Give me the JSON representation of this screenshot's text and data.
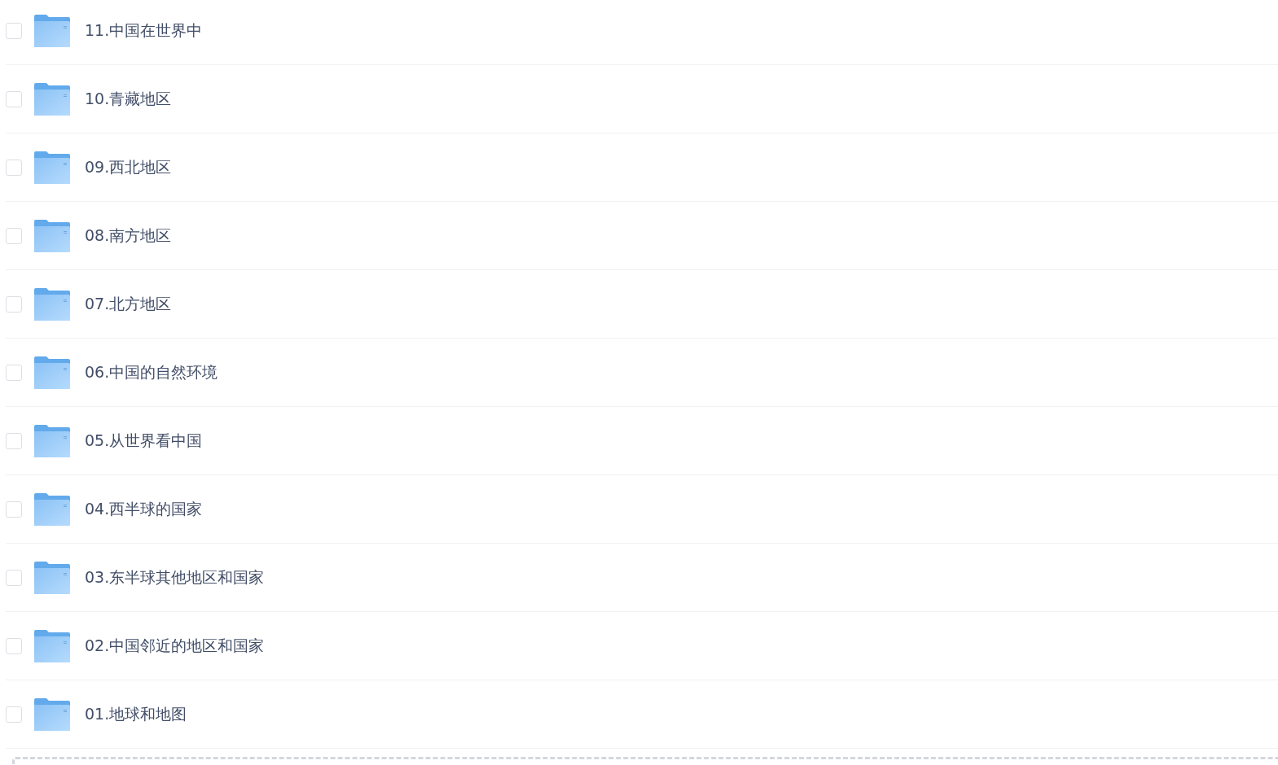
{
  "folders": [
    {
      "name": "11.中国在世界中",
      "checked": false
    },
    {
      "name": "10.青藏地区",
      "checked": false
    },
    {
      "name": "09.西北地区",
      "checked": false
    },
    {
      "name": "08.南方地区",
      "checked": false
    },
    {
      "name": "07.北方地区",
      "checked": false
    },
    {
      "name": "06.中国的自然环境",
      "checked": false
    },
    {
      "name": "05.从世界看中国",
      "checked": false
    },
    {
      "name": "04.西半球的国家",
      "checked": false
    },
    {
      "name": "03.东半球其他地区和国家",
      "checked": false
    },
    {
      "name": "02.中国邻近的地区和国家",
      "checked": false
    },
    {
      "name": "01.地球和地图",
      "checked": false
    }
  ]
}
